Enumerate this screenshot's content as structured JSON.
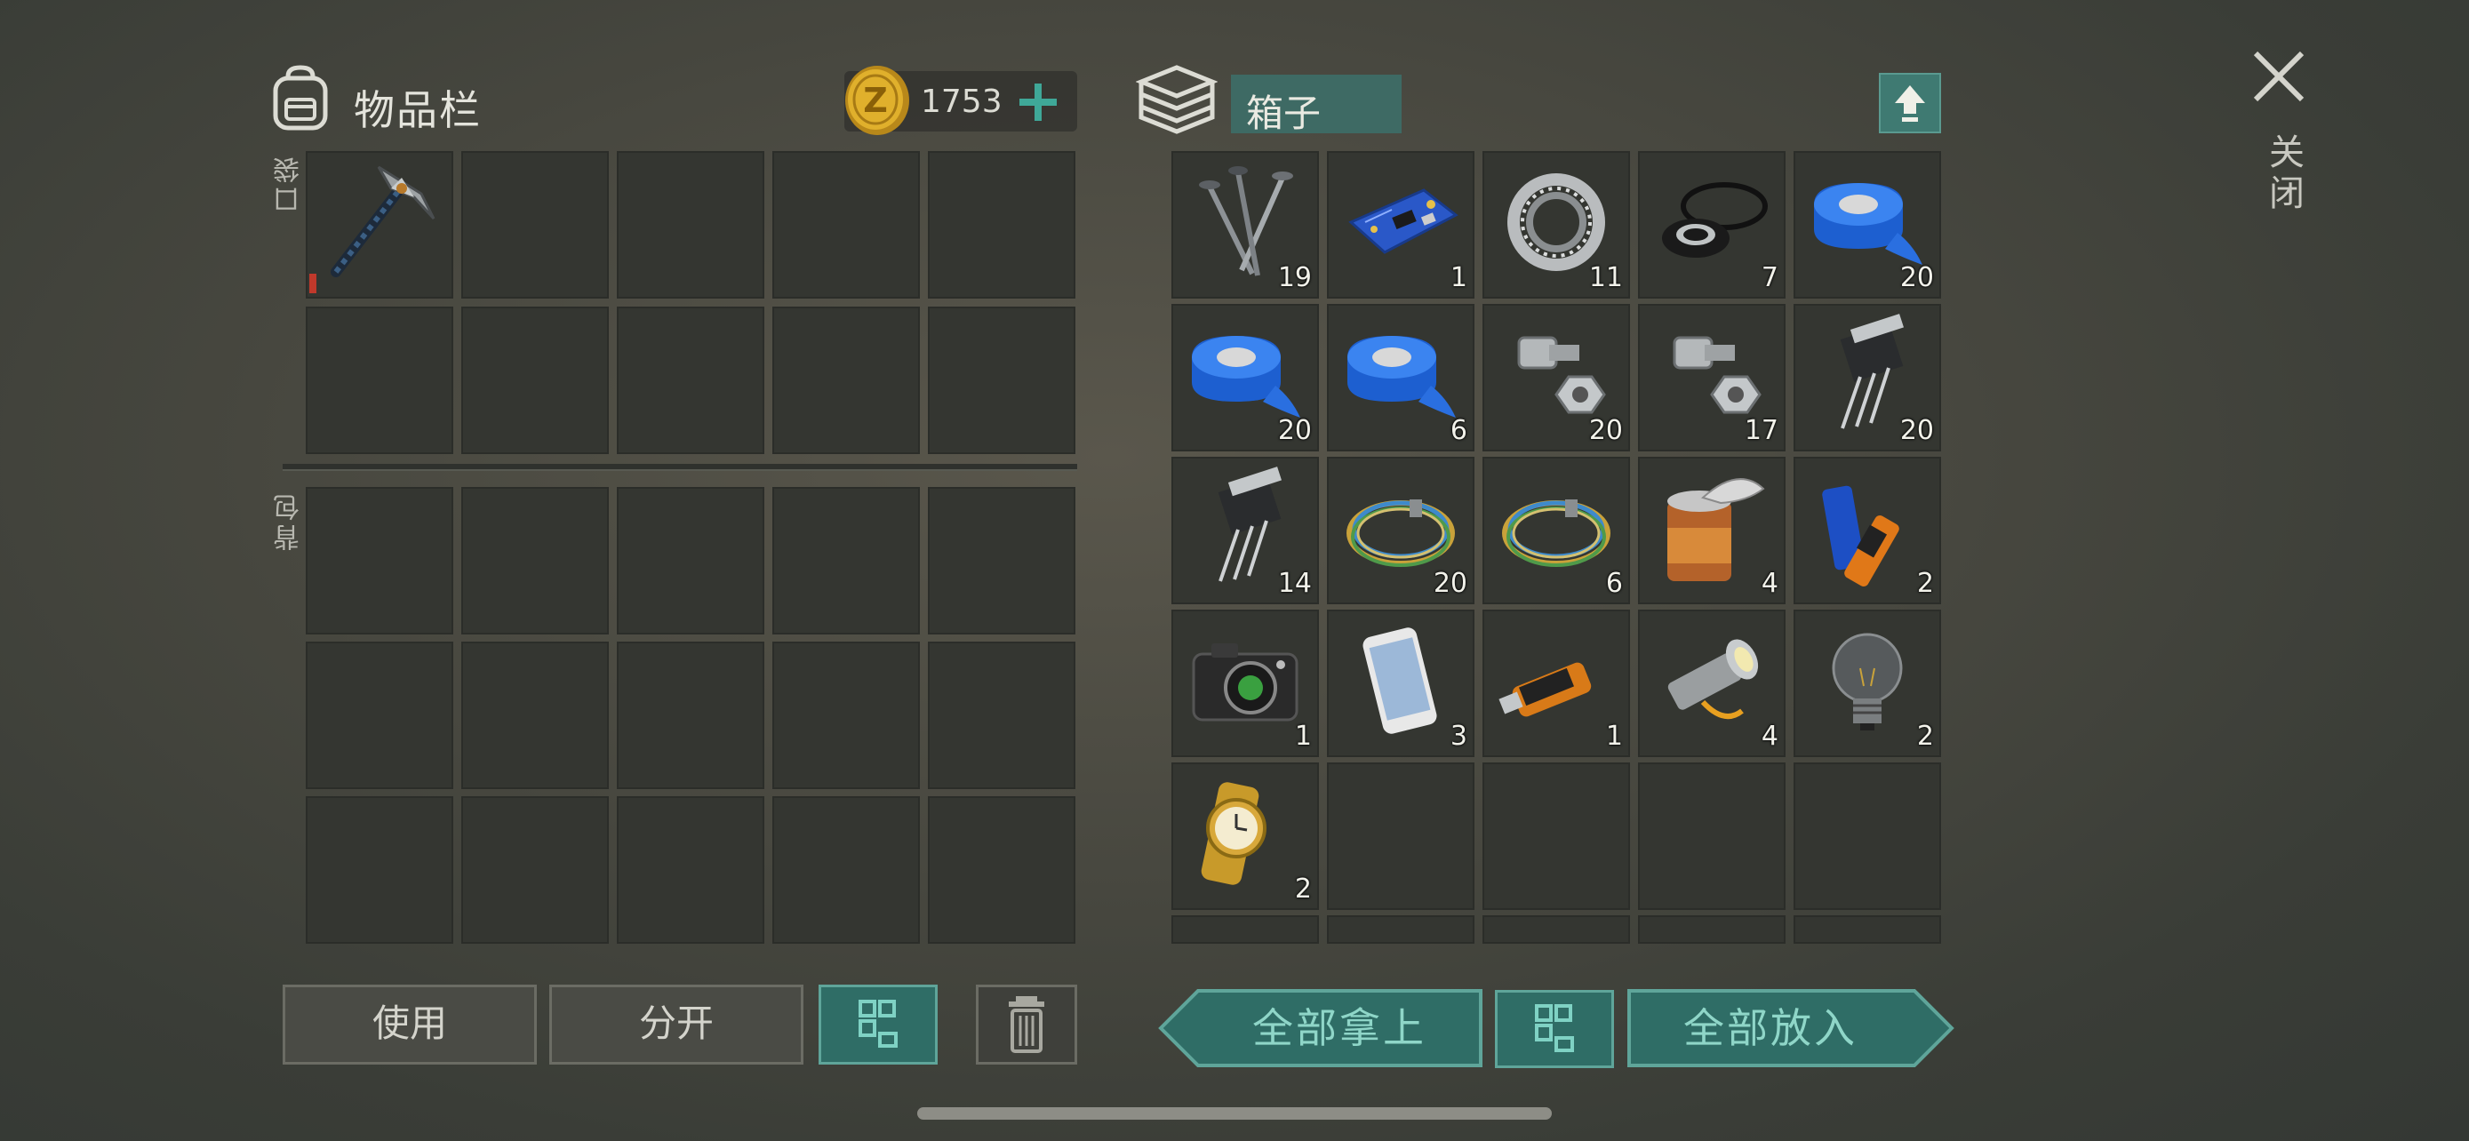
{
  "inventory": {
    "title": "物品栏",
    "currency": "1753",
    "pocket_label": "口袋",
    "backpack_label": "背包",
    "equipped_item": "pickaxe-icon"
  },
  "container": {
    "name": "箱子",
    "items": [
      {
        "icon": "nails-icon",
        "qty": "19"
      },
      {
        "icon": "circuit-board-icon",
        "qty": "1"
      },
      {
        "icon": "bearing-icon",
        "qty": "11"
      },
      {
        "icon": "rubber-seals-icon",
        "qty": "7"
      },
      {
        "icon": "blue-tape-icon",
        "qty": "20"
      },
      {
        "icon": "blue-tape-icon",
        "qty": "20"
      },
      {
        "icon": "blue-tape-icon",
        "qty": "6"
      },
      {
        "icon": "bolt-nut-icon",
        "qty": "20"
      },
      {
        "icon": "bolt-nut-icon",
        "qty": "17"
      },
      {
        "icon": "transistor-icon",
        "qty": "20"
      },
      {
        "icon": "transistor-icon",
        "qty": "14"
      },
      {
        "icon": "wire-coil-icon",
        "qty": "20"
      },
      {
        "icon": "wire-coil-icon",
        "qty": "6"
      },
      {
        "icon": "tin-can-icon",
        "qty": "4"
      },
      {
        "icon": "batteries-icon",
        "qty": "2"
      },
      {
        "icon": "camera-icon",
        "qty": "1"
      },
      {
        "icon": "smartphone-icon",
        "qty": "3"
      },
      {
        "icon": "usb-drive-icon",
        "qty": "1"
      },
      {
        "icon": "flashlight-icon",
        "qty": "4"
      },
      {
        "icon": "light-bulb-icon",
        "qty": "2"
      },
      {
        "icon": "gold-watch-icon",
        "qty": "2"
      }
    ]
  },
  "close_label": "关闭",
  "buttons": {
    "use": "使用",
    "split": "分开",
    "take_all": "全部拿上",
    "put_all": "全部放入"
  },
  "colors": {
    "accent_teal": "#2f6d66",
    "slot_bg": "#343631"
  }
}
